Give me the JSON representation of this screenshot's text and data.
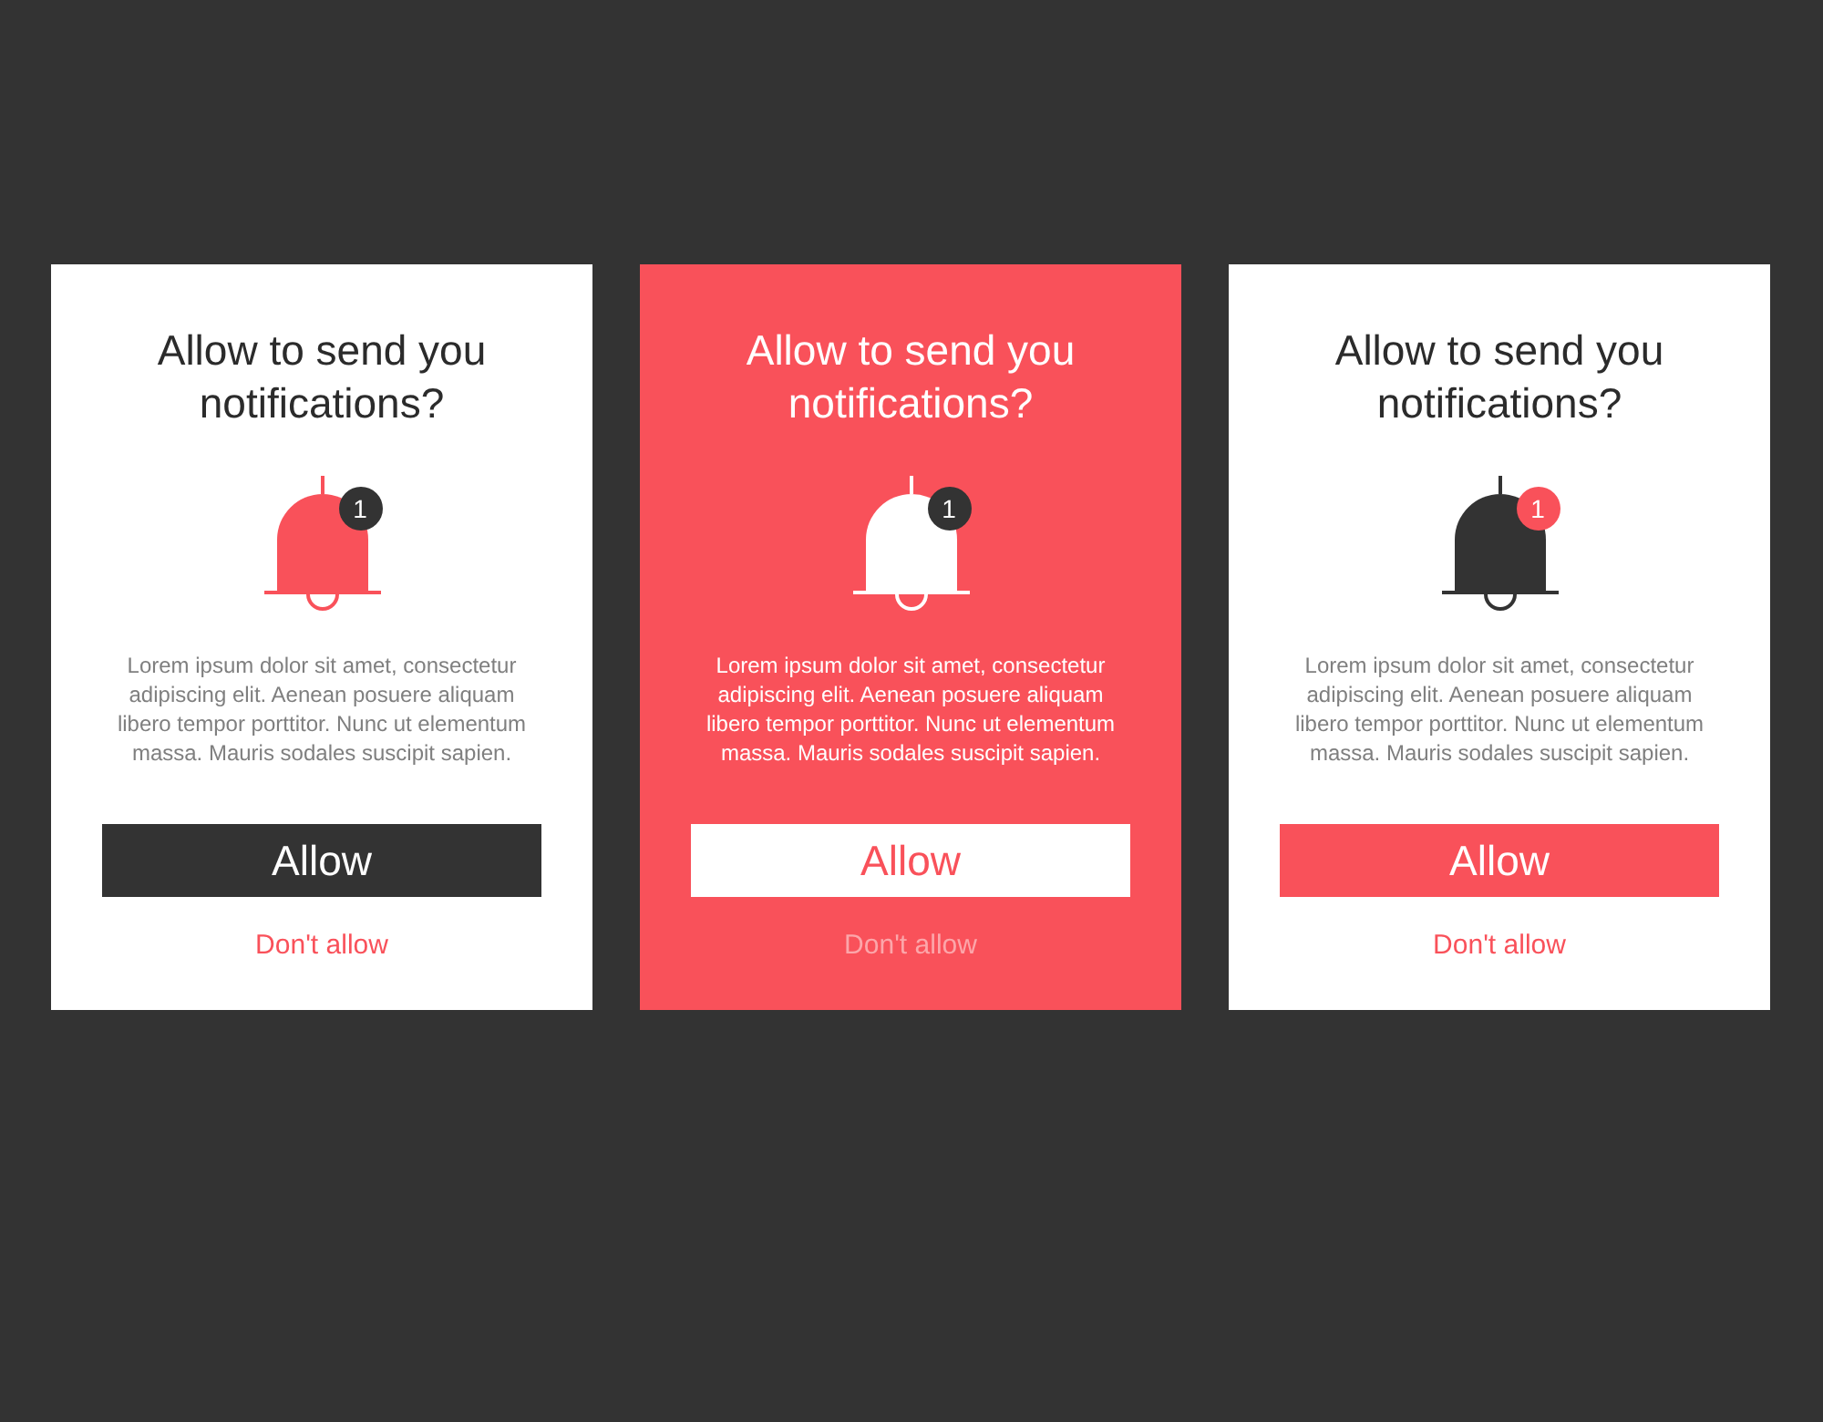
{
  "cards": [
    {
      "kind": "dark",
      "title": "Allow to send you notifications?",
      "badge": "1",
      "body": "Lorem ipsum dolor sit amet, consectetur adipiscing elit. Aenean posuere aliquam libero tempor porttitor. Nunc ut elementum massa. Mauris sodales suscipit sapien.",
      "allow_button": "Allow",
      "deny_link": "Don't allow"
    },
    {
      "kind": "inverted",
      "title": "Allow to send you notifications?",
      "badge": "1",
      "body": "Lorem ipsum dolor sit amet, consectetur adipiscing elit. Aenean posuere aliquam libero tempor porttitor. Nunc ut elementum massa. Mauris sodales suscipit sapien.",
      "allow_button": "Allow",
      "deny_link": "Don't allow"
    },
    {
      "kind": "accent",
      "title": "Allow to send you notifications?",
      "badge": "1",
      "body": "Lorem ipsum dolor sit amet, consectetur adipiscing elit. Aenean posuere aliquam libero tempor porttitor. Nunc ut elementum massa. Mauris sodales suscipit sapien.",
      "allow_button": "Allow",
      "deny_link": "Don't allow"
    }
  ]
}
